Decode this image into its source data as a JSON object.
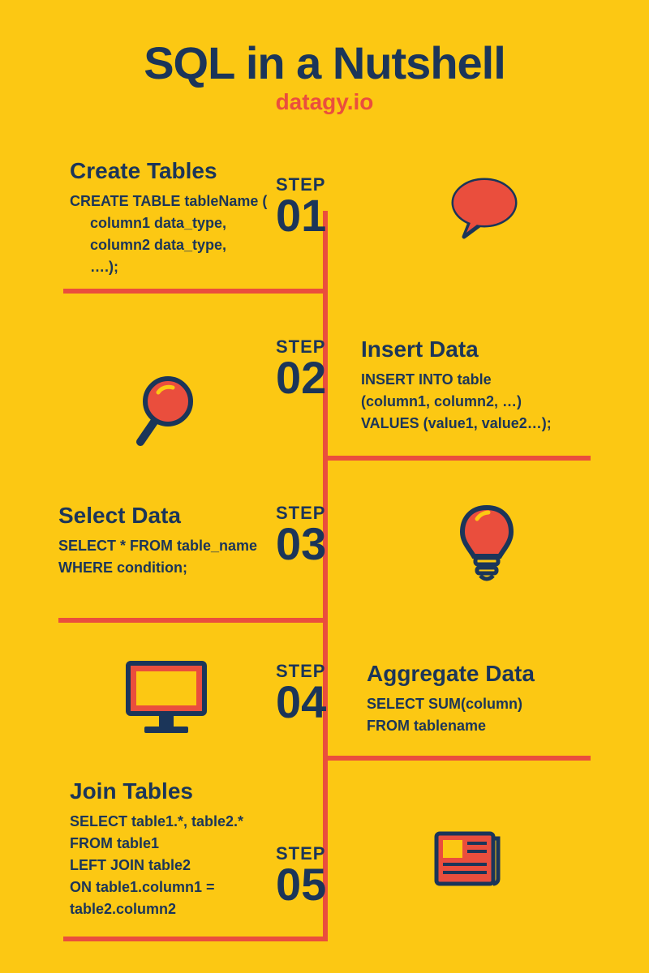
{
  "header": {
    "title": "SQL in a Nutshell",
    "subtitle": "datagy.io"
  },
  "steps": [
    {
      "label": "STEP",
      "num": "01",
      "heading": "Create  Tables",
      "code": "CREATE TABLE tableName (\n     column1 data_type,\n     column2 data_type,\n     ….);"
    },
    {
      "label": "STEP",
      "num": "02",
      "heading": "Insert Data",
      "code": "INSERT INTO table\n(column1, column2, …)\nVALUES (value1, value2…);"
    },
    {
      "label": "STEP",
      "num": "03",
      "heading": "Select Data",
      "code": "SELECT * FROM table_name\nWHERE condition;"
    },
    {
      "label": "STEP",
      "num": "04",
      "heading": " Aggregate Data",
      "code": "SELECT SUM(column)\nFROM tablename"
    },
    {
      "label": "STEP",
      "num": "05",
      "heading": "Join Tables",
      "code": "SELECT table1.*, table2.*\nFROM table1\nLEFT JOIN table2\nON table1.column1 =\ntable2.column2"
    }
  ]
}
